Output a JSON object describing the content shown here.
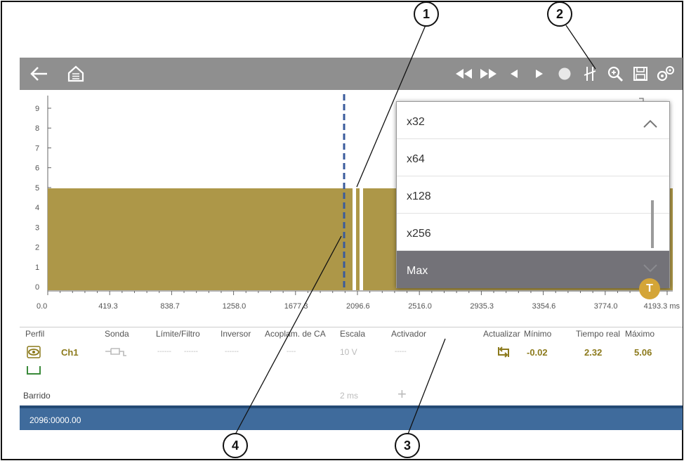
{
  "toolbar": {
    "left_icons": [
      "back-arrow-icon",
      "home-icon"
    ],
    "right_icons": [
      "skip-back-icon",
      "skip-forward-icon",
      "step-back-icon",
      "step-forward-icon",
      "record-icon",
      "cursor-icon",
      "zoom-icon",
      "save-icon",
      "settings-icon"
    ]
  },
  "y_axis": {
    "ticks": [
      "0",
      "1",
      "2",
      "3",
      "4",
      "5",
      "6",
      "7",
      "8",
      "9"
    ]
  },
  "x_axis": {
    "ticks": [
      "0.0",
      "419.3",
      "838.7",
      "1258.0",
      "1677.3",
      "2096.6",
      "2516.0",
      "2935.3",
      "3354.6",
      "3774.0",
      "4193.3 ms"
    ]
  },
  "trigger_marker": {
    "value": "T"
  },
  "zoom_menu": {
    "items": [
      "x32",
      "x64",
      "x128",
      "x256",
      "Max"
    ],
    "selected": "Max"
  },
  "channel": {
    "headers": {
      "perfil": "Perfil",
      "sonda": "Sonda",
      "limite": "Límite/Filtro",
      "inversor": "Inversor",
      "acoplam": "Acoplam. de CA",
      "escala": "Escala",
      "activador": "Activador",
      "actualizar": "Actualizar",
      "minimo": "Mínimo",
      "tiempo": "Tiempo real",
      "maximo": "Máximo"
    },
    "name": "Ch1",
    "limite_value1": "------",
    "limite_value2": "------",
    "inversor_value": "------",
    "acoplam_value": "----",
    "escala_value": "10 V",
    "activador_value": "-----",
    "minimo": "-0.02",
    "tiempo_real": "2.32",
    "maximo": "5.06",
    "barrido_label": "Barrido",
    "barrido_value": "2 ms",
    "plus_label": "+"
  },
  "status": {
    "text": "2096:0000.00"
  },
  "callouts": [
    "1",
    "2",
    "3",
    "4"
  ],
  "colors": {
    "waveform": "#ad9748",
    "toolbar": "#8f8f8f",
    "status": "#3f6b9c",
    "accent": "#8c7a1c"
  }
}
